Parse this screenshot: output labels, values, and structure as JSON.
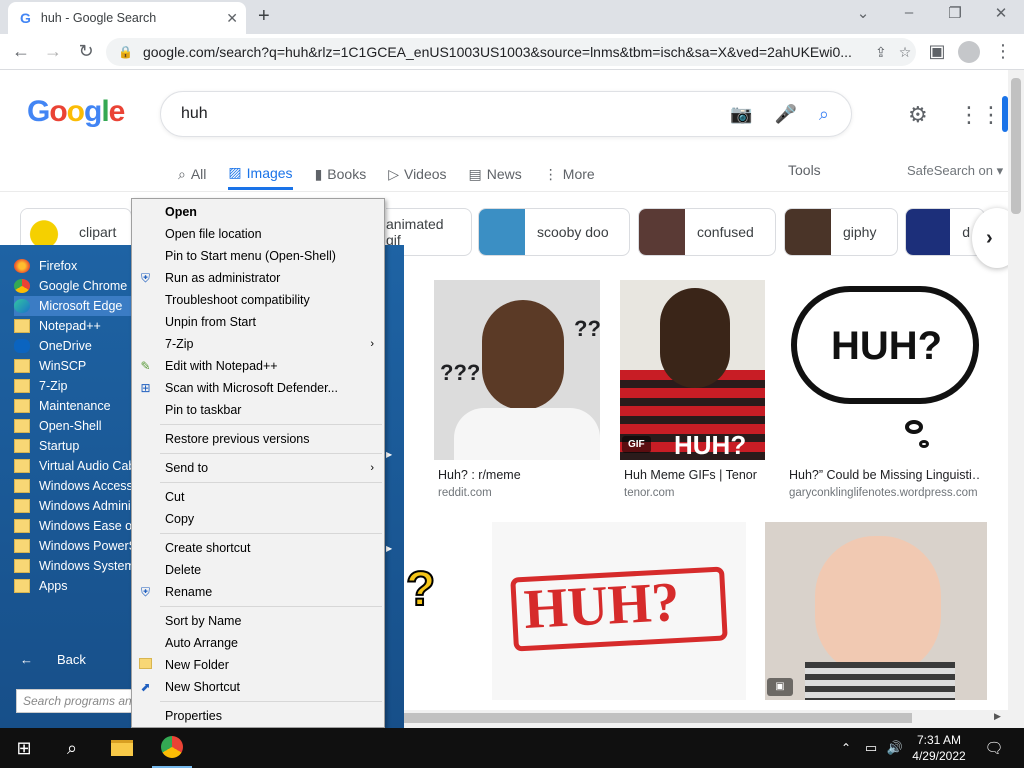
{
  "browser": {
    "tab_title": "huh - Google Search",
    "address": "google.com/search?q=huh&rlz=1C1GCEA_enUS1003US1003&source=lnms&tbm=isch&sa=X&ved=2ahUKEwi0..."
  },
  "google": {
    "logo_text": "Google",
    "query": "huh",
    "tabs": [
      {
        "label": "All",
        "icon": "search-icon"
      },
      {
        "label": "Images",
        "icon": "image-icon"
      },
      {
        "label": "Books",
        "icon": "book-icon"
      },
      {
        "label": "Videos",
        "icon": "video-icon"
      },
      {
        "label": "News",
        "icon": "news-icon"
      },
      {
        "label": "More",
        "icon": "more-icon"
      }
    ],
    "tools_label": "Tools",
    "safesearch_label": "SafeSearch on"
  },
  "chips": [
    "clipart",
    "animated gif",
    "scooby doo",
    "confused",
    "giphy",
    "d"
  ],
  "results": [
    {
      "caption": "Huh? : r/meme",
      "source": "reddit.com",
      "overlay": "???"
    },
    {
      "caption": "Huh Meme GIFs | Tenor",
      "source": "tenor.com",
      "overlay": "HUH?",
      "badge": "GIF"
    },
    {
      "caption": "Huh?” Could be Missing Linguisti…",
      "source": "garyconklinglifenotes.wordpress.com",
      "overlay": "HUH?"
    },
    {
      "overlay": "HUH?"
    },
    {
      "overlay": "?"
    }
  ],
  "start_menu": {
    "items": [
      "Firefox",
      "Google Chrome",
      "Microsoft Edge",
      "Notepad++",
      "OneDrive",
      "WinSCP",
      "7-Zip",
      "Maintenance",
      "Open-Shell",
      "Startup",
      "Virtual Audio Cable",
      "Windows Accessories",
      "Windows Administrative Tools",
      "Windows Ease of Access",
      "Windows PowerShell",
      "Windows System",
      "Apps"
    ],
    "back_label": "Back",
    "search_placeholder": "Search programs and files"
  },
  "context_menu": {
    "group1": [
      "Open",
      "Open file location",
      "Pin to Start menu (Open-Shell)",
      "Run as administrator",
      "Troubleshoot compatibility",
      "Unpin from Start",
      "7-Zip",
      "Edit with Notepad++",
      "Scan with Microsoft Defender...",
      "Pin to taskbar"
    ],
    "group2": [
      "Restore previous versions"
    ],
    "group3": [
      "Send to"
    ],
    "group4": [
      "Cut",
      "Copy"
    ],
    "group5": [
      "Create shortcut",
      "Delete",
      "Rename"
    ],
    "group6": [
      "Sort by Name",
      "Auto Arrange",
      "New Folder",
      "New Shortcut"
    ],
    "group7": [
      "Properties"
    ]
  },
  "taskbar": {
    "time": "7:31 AM",
    "date": "4/29/2022"
  },
  "colors": {
    "accent": "#1a73e8",
    "start_menu_bg": "#1e63a4",
    "taskbar_bg": "#101010"
  }
}
